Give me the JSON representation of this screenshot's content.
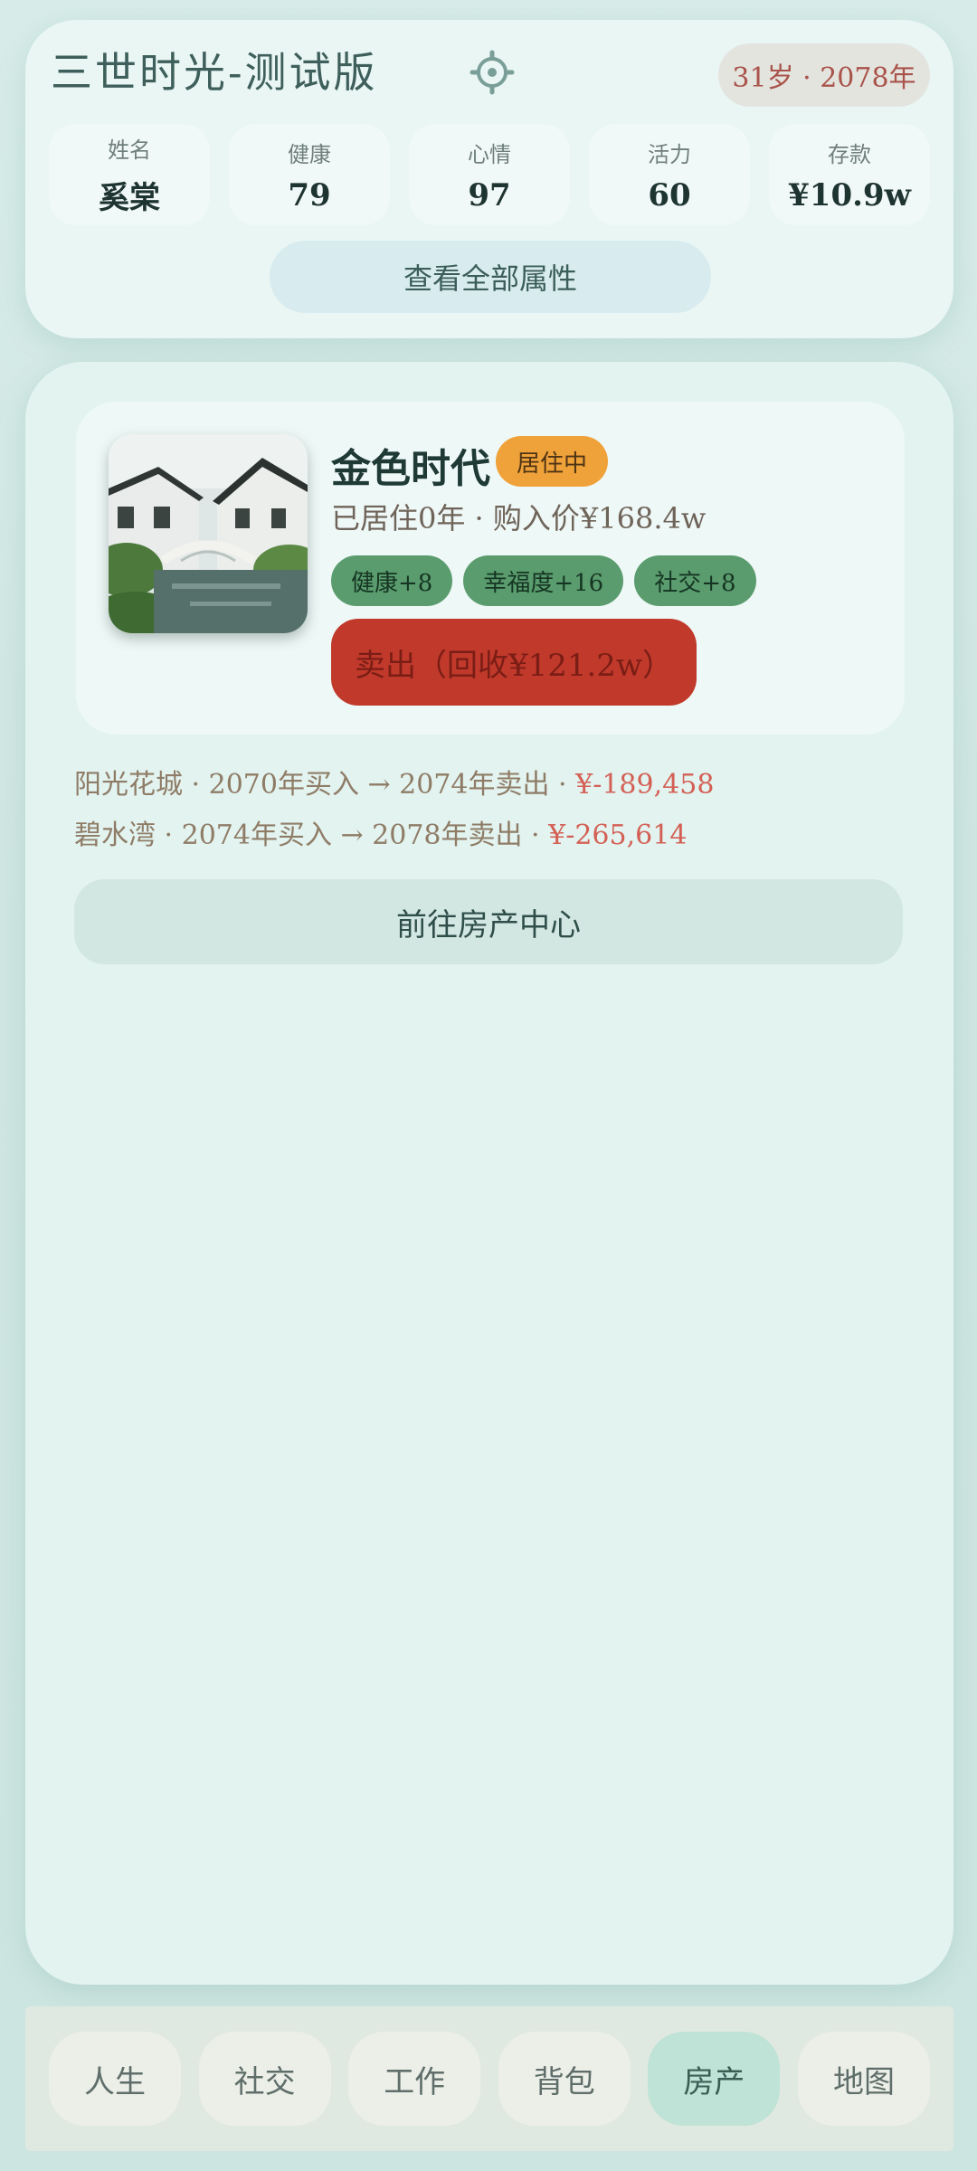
{
  "header": {
    "title": "三世时光-测试版",
    "age_year": "31岁 · 2078年",
    "stats": [
      {
        "label": "姓名",
        "value": "奚棠"
      },
      {
        "label": "健康",
        "value": "79"
      },
      {
        "label": "心情",
        "value": "97"
      },
      {
        "label": "活力",
        "value": "60"
      },
      {
        "label": "存款",
        "value": "¥10.9w"
      }
    ],
    "view_all_label": "查看全部属性"
  },
  "house": {
    "name": "金色时代",
    "status_badge": "居住中",
    "info": "已居住0年 · 购入价¥168.4w",
    "tags": [
      "健康+8",
      "幸福度+16",
      "社交+8"
    ],
    "sell_label": "卖出（回收¥121.2w）"
  },
  "history": [
    {
      "text": "阳光花城 · 2070年买入 → 2074年卖出 · ",
      "amount": "¥-189,458"
    },
    {
      "text": "碧水湾 · 2074年买入 → 2078年卖出 · ",
      "amount": "¥-265,614"
    }
  ],
  "goto_center_label": "前往房产中心",
  "nav": {
    "items": [
      "人生",
      "社交",
      "工作",
      "背包",
      "房产",
      "地图"
    ],
    "active": "房产"
  },
  "icons": {
    "settings": "gear-icon",
    "house_image": "house-photo-icon"
  },
  "colors": {
    "accent": "#5a9c6e",
    "sell": "#c0392b",
    "badge": "#f0a23a",
    "loss": "#d46055"
  }
}
